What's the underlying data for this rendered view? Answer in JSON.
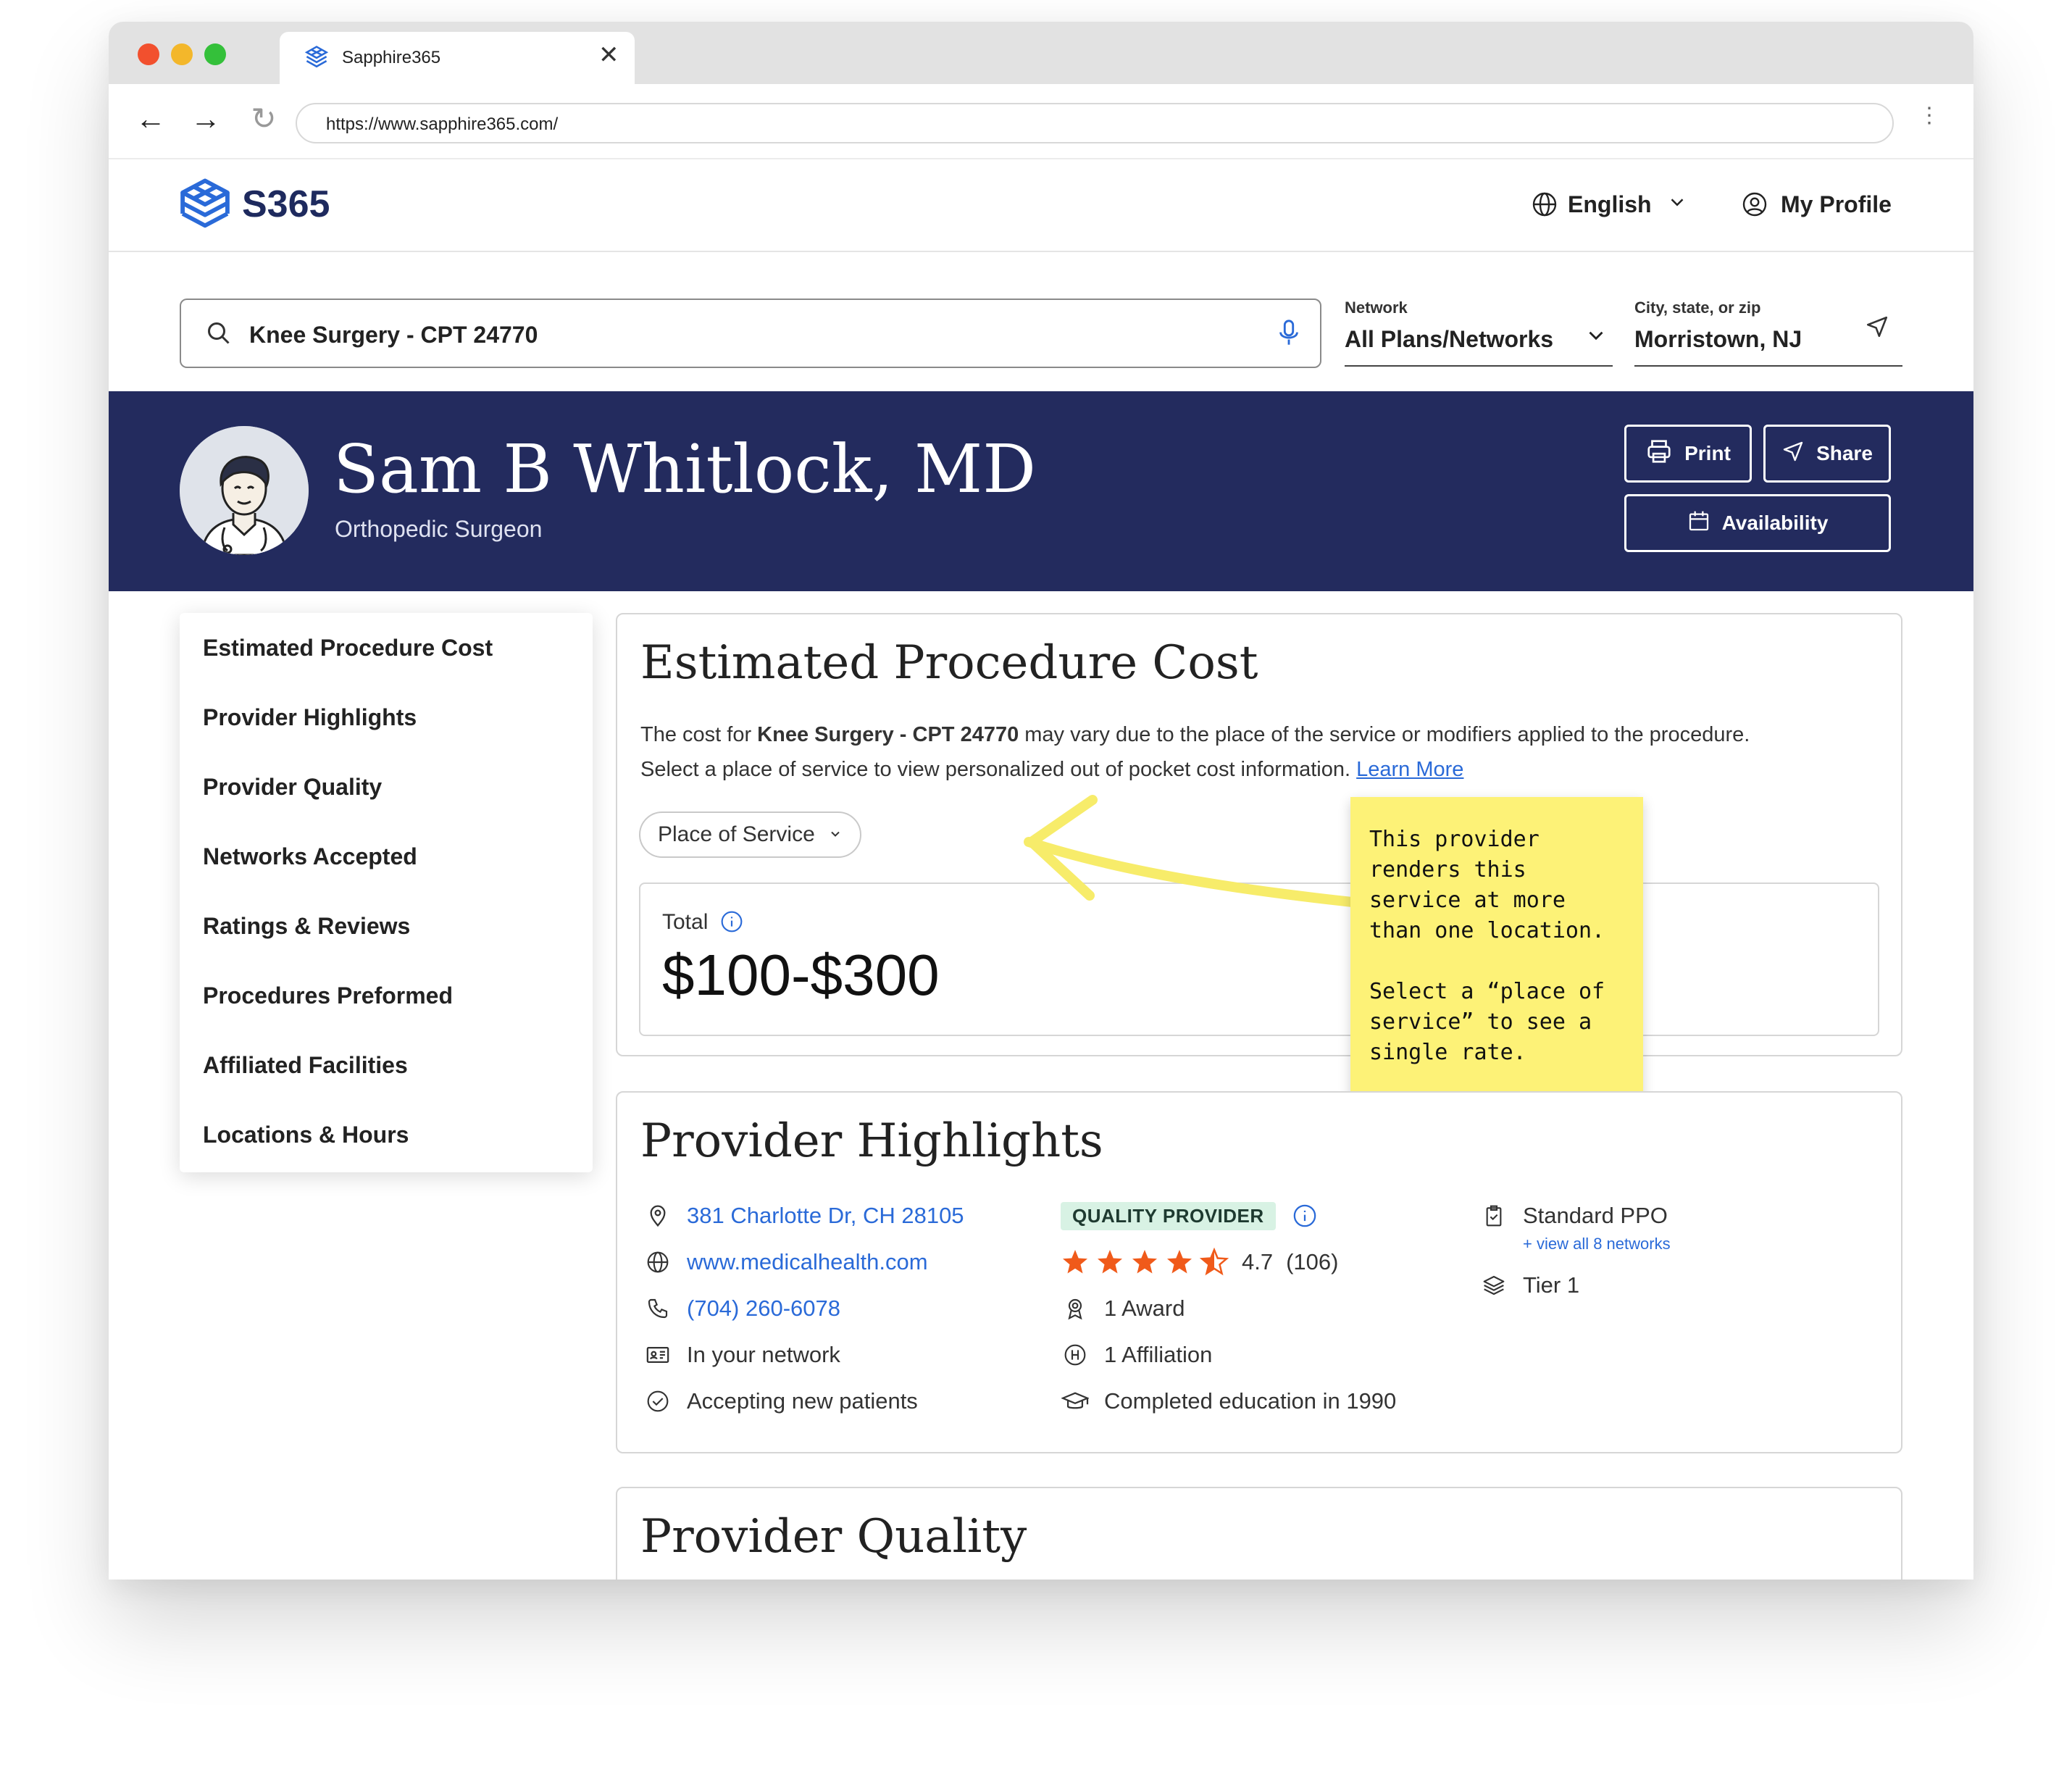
{
  "browser": {
    "tab_title": "Sapphire365",
    "url": "https://www.sapphire365.com/"
  },
  "header": {
    "logo_text": "S365",
    "language": "English",
    "profile": "My Profile"
  },
  "search": {
    "query": "Knee Surgery - CPT 24770",
    "network_label": "Network",
    "network_value": "All Plans/Networks",
    "location_label": "City, state, or zip",
    "location_value": "Morristown, NJ"
  },
  "provider": {
    "name": "Sam B Whitlock, MD",
    "specialty": "Orthopedic Surgeon",
    "print_label": "Print",
    "share_label": "Share",
    "availability_label": "Availability"
  },
  "sidebar": {
    "items": [
      {
        "label": "Estimated Procedure Cost"
      },
      {
        "label": "Provider Highlights"
      },
      {
        "label": "Provider Quality"
      },
      {
        "label": "Networks Accepted"
      },
      {
        "label": "Ratings & Reviews"
      },
      {
        "label": "Procedures Preformed"
      },
      {
        "label": "Affiliated Facilities"
      },
      {
        "label": "Locations & Hours"
      }
    ]
  },
  "cost": {
    "title": "Estimated Procedure Cost",
    "text_prefix": "The cost for ",
    "text_bold": "Knee Surgery - CPT 24770",
    "text_suffix": " may vary due to the place of the service or modifiers applied to the procedure.",
    "text_line2": "Select a place of service to view personalized out of pocket cost information.",
    "learn_more": "Learn More",
    "place_of_service": "Place of Service",
    "total_label": "Total",
    "total_value": "$100-$300"
  },
  "sticky_note": {
    "text": "This provider\nrenders this\nservice at more\nthan one location.\n\nSelect a “place of\nservice” to see a\nsingle rate."
  },
  "highlights": {
    "title": "Provider Highlights",
    "address": "381 Charlotte Dr, CH 28105",
    "website": "www.medicalhealth.com",
    "phone": "(704) 260-6078",
    "in_network": "In your network",
    "accepting": "Accepting new patients",
    "quality_badge": "QUALITY PROVIDER",
    "rating": "4.7",
    "rating_value": 4.7,
    "review_count": "(106)",
    "award": "1 Award",
    "affiliation": "1 Affiliation",
    "education": "Completed education in 1990",
    "plan": "Standard PPO",
    "view_networks": "+ view all 8 networks",
    "tier": "Tier 1"
  },
  "quality": {
    "title": "Provider Quality"
  },
  "colors": {
    "banner": "#232b5e",
    "link": "#2a6ad8",
    "sticky": "#fdf277",
    "star": "#f05a1a",
    "badge_bg": "#d8f2e4"
  }
}
